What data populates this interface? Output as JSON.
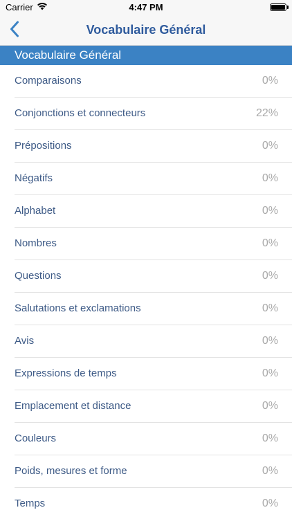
{
  "status_bar": {
    "carrier": "Carrier",
    "time": "4:47 PM"
  },
  "nav": {
    "title": "Vocabulaire Général",
    "back_icon": "chevron-left-icon"
  },
  "section": {
    "title": "Vocabulaire Général"
  },
  "colors": {
    "accent": "#3b82c4",
    "title": "#2f5b9d",
    "label": "#3d5a86",
    "value": "#a9a9a9"
  },
  "items": [
    {
      "label": "Comparaisons",
      "value": "0%"
    },
    {
      "label": "Conjonctions et connecteurs",
      "value": "22%"
    },
    {
      "label": "Prépositions",
      "value": "0%"
    },
    {
      "label": "Négatifs",
      "value": "0%"
    },
    {
      "label": "Alphabet",
      "value": "0%"
    },
    {
      "label": "Nombres",
      "value": "0%"
    },
    {
      "label": "Questions",
      "value": "0%"
    },
    {
      "label": "Salutations et exclamations",
      "value": "0%"
    },
    {
      "label": "Avis",
      "value": "0%"
    },
    {
      "label": "Expressions de temps",
      "value": "0%"
    },
    {
      "label": "Emplacement et distance",
      "value": "0%"
    },
    {
      "label": "Couleurs",
      "value": "0%"
    },
    {
      "label": "Poids, mesures et forme",
      "value": "0%"
    },
    {
      "label": "Temps",
      "value": "0%"
    }
  ]
}
